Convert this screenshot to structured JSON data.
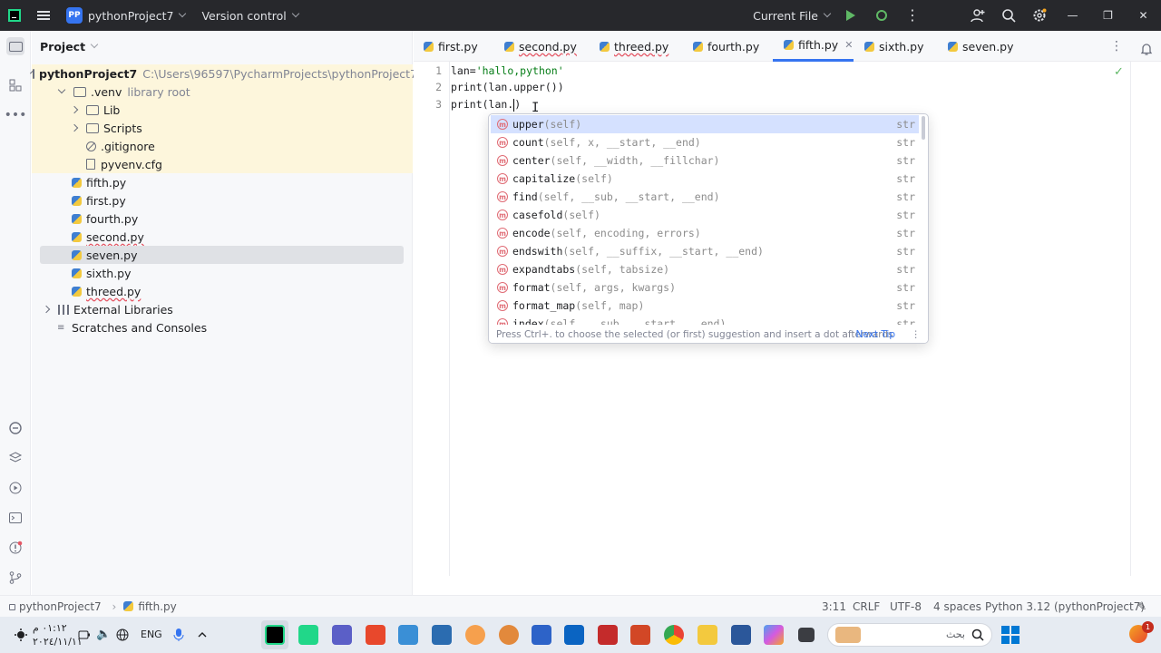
{
  "titlebar": {
    "project_badge": "PP",
    "project_name": "pythonProject7",
    "vcs_label": "Version control",
    "run_config": "Current File",
    "icons": [
      "hamburger-icon",
      "run-icon",
      "debug-icon",
      "more-icon",
      "add-user-icon",
      "search-icon",
      "settings-icon"
    ]
  },
  "project_panel": {
    "title": "Project",
    "root_name": "pythonProject7",
    "root_path": "C:\\Users\\96597\\PycharmProjects\\pythonProject7",
    "venv_name": ".venv",
    "venv_note": "library root",
    "lib": "Lib",
    "scripts": "Scripts",
    "gitignore": ".gitignore",
    "pyvenv": "pyvenv.cfg",
    "files": [
      "fifth.py",
      "first.py",
      "fourth.py",
      "second.py",
      "seven.py",
      "sixth.py",
      "threed.py"
    ],
    "external_libraries": "External Libraries",
    "scratches": "Scratches and Consoles"
  },
  "tabs": [
    "first.py",
    "second.py",
    "threed.py",
    "fourth.py",
    "fifth.py",
    "sixth.py",
    "seven.py"
  ],
  "active_tab": "fifth.py",
  "editor": {
    "line_numbers": [
      "1",
      "2",
      "3"
    ],
    "line1_pre": "lan=",
    "line1_str": "'hallo,python'",
    "line2": "print(lan.upper())",
    "line3_pre": "print(lan.",
    "line3_post": ")"
  },
  "completion": {
    "items": [
      {
        "name": "upper",
        "sig": "(self)",
        "type": "str"
      },
      {
        "name": "count",
        "sig": "(self, x, __start, __end)",
        "type": "str"
      },
      {
        "name": "center",
        "sig": "(self, __width, __fillchar)",
        "type": "str"
      },
      {
        "name": "capitalize",
        "sig": "(self)",
        "type": "str"
      },
      {
        "name": "find",
        "sig": "(self, __sub, __start, __end)",
        "type": "str"
      },
      {
        "name": "casefold",
        "sig": "(self)",
        "type": "str"
      },
      {
        "name": "encode",
        "sig": "(self, encoding, errors)",
        "type": "str"
      },
      {
        "name": "endswith",
        "sig": "(self, __suffix, __start, __end)",
        "type": "str"
      },
      {
        "name": "expandtabs",
        "sig": "(self, tabsize)",
        "type": "str"
      },
      {
        "name": "format",
        "sig": "(self, args, kwargs)",
        "type": "str"
      },
      {
        "name": "format_map",
        "sig": "(self, map)",
        "type": "str"
      },
      {
        "name": "index",
        "sig": "(self, __sub, __start, __end)",
        "type": "str"
      }
    ],
    "badge": "m",
    "footer": "Press Ctrl+. to choose the selected (or first) suggestion and insert a dot afterwards",
    "next_tip": "Next Tip"
  },
  "statusbar": {
    "breadcrumb_project": "pythonProject7",
    "breadcrumb_file": "fifth.py",
    "position": "3:11",
    "line_sep": "CRLF",
    "encoding": "UTF-8",
    "indent": "4 spaces",
    "interpreter": "Python 3.12 (pythonProject7)"
  },
  "taskbar": {
    "time": "٠١:١٢ م",
    "date": "٢٠٢٤/١١/١١",
    "language": "ENG",
    "search_placeholder": "بحث",
    "notification_count": "1"
  }
}
